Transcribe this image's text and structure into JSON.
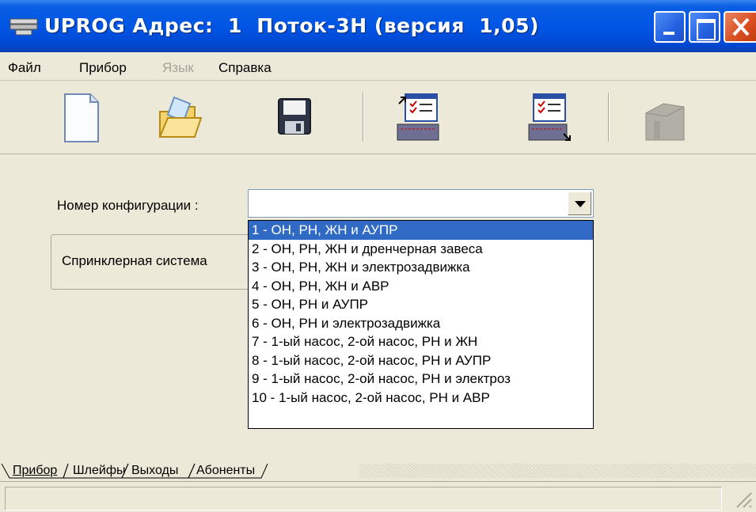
{
  "window": {
    "title": "UPROG Адрес:  1  Поток-3Н (версия  1,05)",
    "controls": [
      "minimize",
      "maximize",
      "close"
    ]
  },
  "menu": {
    "items": [
      {
        "label": "Файл",
        "enabled": true
      },
      {
        "label": "Прибор",
        "enabled": true
      },
      {
        "label": "Язык",
        "enabled": false
      },
      {
        "label": "Справка",
        "enabled": true
      }
    ]
  },
  "toolbar": {
    "buttons": [
      {
        "icon": "new-document-icon",
        "enabled": true
      },
      {
        "icon": "open-folder-icon",
        "enabled": true
      },
      {
        "icon": "save-floppy-icon",
        "enabled": true
      },
      {
        "icon": "read-from-device-icon",
        "enabled": true
      },
      {
        "icon": "write-to-device-icon",
        "enabled": true
      },
      {
        "icon": "device-icon",
        "enabled": false
      }
    ]
  },
  "config": {
    "label": "Номер конфигурации :",
    "value": "",
    "group_text": "Спринклерная система"
  },
  "dropdown": {
    "selected_index": 0,
    "options": [
      "1 - ОН, РН, ЖН и АУПР",
      "2 - ОН, РН, ЖН и дренчерная завеса",
      "3 - ОН, РН, ЖН и электрозадвижка",
      "4 - ОН, РН, ЖН и АВР",
      "5 - ОН, РН и АУПР",
      "6 - ОН, РН и электрозадвижка",
      "7 - 1-ый насос, 2-ой насос, РН и ЖН",
      "8 - 1-ый насос, 2-ой насос, РН и АУПР",
      "9 - 1-ый насос, 2-ой насос, РН и электроз",
      "10 - 1-ый насос, 2-ой насос, РН и АВР"
    ]
  },
  "tabs": [
    {
      "label": "Прибор",
      "active": true
    },
    {
      "label": "Шлейфы",
      "active": false
    },
    {
      "label": "Выходы",
      "active": false
    },
    {
      "label": "Абоненты",
      "active": false
    }
  ],
  "colors": {
    "titlebar": "#0055e5",
    "selection": "#316ac5",
    "face": "#ece9d8"
  }
}
